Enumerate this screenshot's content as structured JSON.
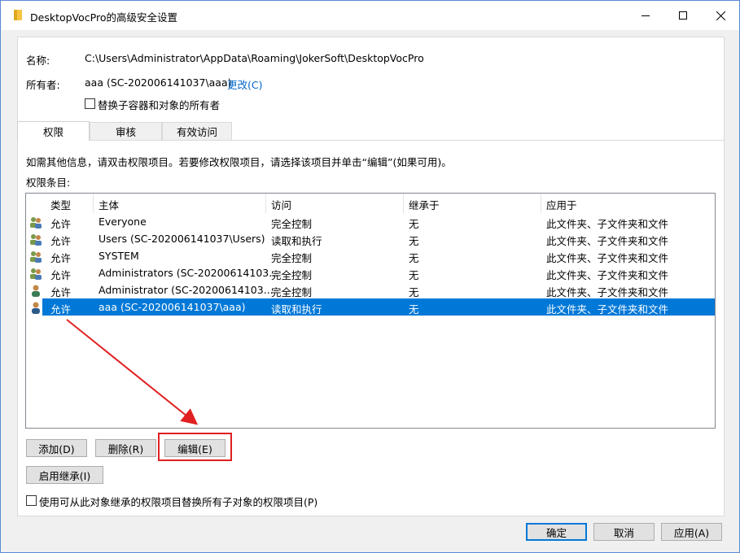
{
  "window": {
    "title": "DesktopVocPro的高级安全设置"
  },
  "info": {
    "name_label": "名称:",
    "name_value": "C:\\Users\\Administrator\\AppData\\Roaming\\JokerSoft\\DesktopVocPro",
    "owner_label": "所有者:",
    "owner_value": "aaa (SC-202006141037\\aaa)",
    "change_link": "更改(C)",
    "replace_owner_checkbox": "替换子容器和对象的所有者"
  },
  "tabs": [
    {
      "label": "权限",
      "active": true
    },
    {
      "label": "审核",
      "active": false
    },
    {
      "label": "有效访问",
      "active": false
    }
  ],
  "permissions": {
    "hint": "如需其他信息，请双击权限项目。若要修改权限项目，请选择该项目并单击“编辑”(如果可用)。",
    "entries_label": "权限条目:",
    "columns": [
      "类型",
      "主体",
      "访问",
      "继承于",
      "应用于"
    ],
    "rows": [
      {
        "type": "允许",
        "principal": "Everyone",
        "access": "完全控制",
        "inherited": "无",
        "applies": "此文件夹、子文件夹和文件",
        "icon": "group-icon",
        "selected": false
      },
      {
        "type": "允许",
        "principal": "Users (SC-202006141037\\Users)",
        "access": "读取和执行",
        "inherited": "无",
        "applies": "此文件夹、子文件夹和文件",
        "icon": "group-icon",
        "selected": false
      },
      {
        "type": "允许",
        "principal": "SYSTEM",
        "access": "完全控制",
        "inherited": "无",
        "applies": "此文件夹、子文件夹和文件",
        "icon": "group-icon",
        "selected": false
      },
      {
        "type": "允许",
        "principal": "Administrators (SC-20200614103...",
        "access": "完全控制",
        "inherited": "无",
        "applies": "此文件夹、子文件夹和文件",
        "icon": "group-icon",
        "selected": false
      },
      {
        "type": "允许",
        "principal": "Administrator (SC-20200614103...",
        "access": "完全控制",
        "inherited": "无",
        "applies": "此文件夹、子文件夹和文件",
        "icon": "user-icon",
        "selected": false
      },
      {
        "type": "允许",
        "principal": "aaa (SC-202006141037\\aaa)",
        "access": "读取和执行",
        "inherited": "无",
        "applies": "此文件夹、子文件夹和文件",
        "icon": "user-icon",
        "selected": true
      }
    ]
  },
  "buttons": {
    "add": "添加(D)",
    "remove": "删除(R)",
    "edit": "编辑(E)",
    "enable_inheritance": "启用继承(I)",
    "replace_child_checkbox": "使用可从此对象继承的权限项目替换所有子对象的权限项目(P)",
    "ok": "确定",
    "cancel": "取消",
    "apply": "应用(A)"
  },
  "colors": {
    "selection": "#0078d7",
    "link": "#0066cc",
    "annotation": "#e02020"
  }
}
